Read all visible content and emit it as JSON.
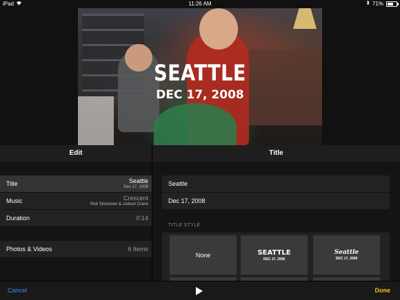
{
  "status_bar": {
    "device": "iPad",
    "time": "11:26 AM",
    "battery": "71%"
  },
  "video": {
    "title": "SEATTLE",
    "date": "DEC 17, 2008"
  },
  "left_panel": {
    "header": "Edit",
    "rows": [
      {
        "label": "Title",
        "value": "Seattle",
        "sub": "Dec 17, 2008"
      },
      {
        "label": "Music",
        "value": "Crescent",
        "sub": "Rob Simonsen & Judson Crane"
      },
      {
        "label": "Duration",
        "value": "0:14"
      },
      {
        "label": "Photos & Videos",
        "value": "6 Items"
      }
    ]
  },
  "right_panel": {
    "header": "Title",
    "title_field": "Seattle",
    "date_field": "Dec 17, 2008",
    "section_label": "TITLE STYLE",
    "styles": [
      {
        "label": "None"
      },
      {
        "title": "SEATTLE",
        "date": "DEC 17, 2008"
      },
      {
        "title": "Seattle",
        "date": "DEC 17, 2008"
      }
    ]
  },
  "toolbar": {
    "cancel_label": "Cancel",
    "done_label": "Done"
  },
  "colors": {
    "accent_blue": "#3a8ef0",
    "accent_yellow": "#f0c020"
  },
  "icons": [
    "wifi-icon",
    "bluetooth-icon",
    "battery-icon",
    "play-icon"
  ]
}
